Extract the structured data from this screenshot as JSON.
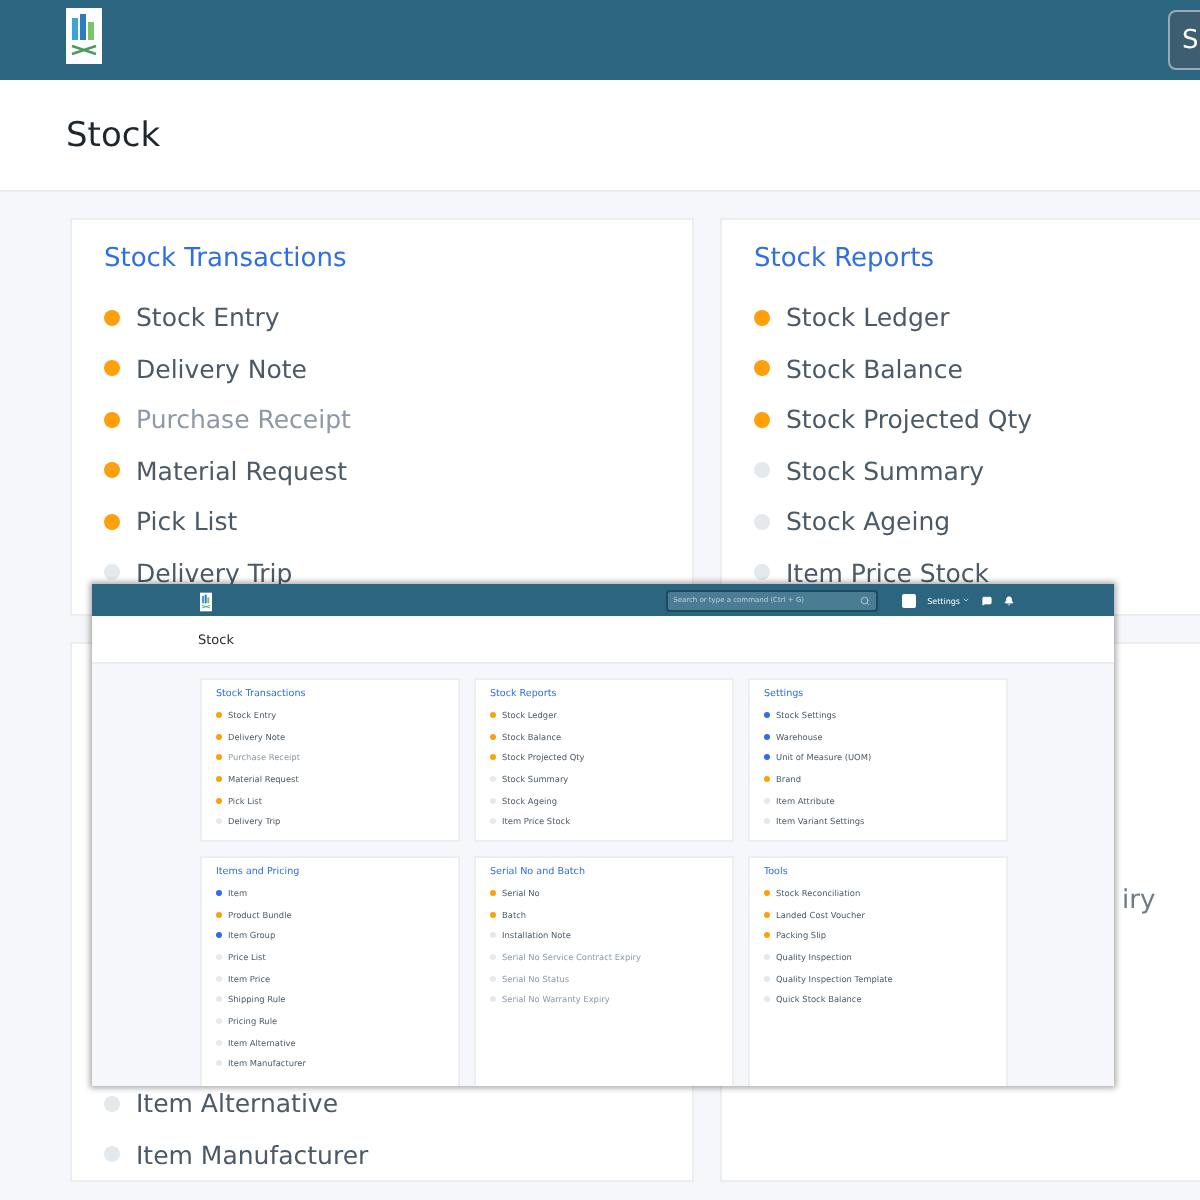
{
  "background": {
    "navbar": {
      "button_text": "S"
    },
    "page_title": "Stock",
    "cards": [
      {
        "title": "Stock Transactions",
        "items": [
          {
            "label": "Stock Entry",
            "color": "#ffa00a",
            "dimmed": false
          },
          {
            "label": "Delivery Note",
            "color": "#ffa00a",
            "dimmed": false
          },
          {
            "label": "Purchase Receipt",
            "color": "#ffa00a",
            "dimmed": true
          },
          {
            "label": "Material Request",
            "color": "#ffa00a",
            "dimmed": false
          },
          {
            "label": "Pick List",
            "color": "#ffa00a",
            "dimmed": false
          },
          {
            "label": "Delivery Trip",
            "color": "#e4e9ee",
            "dimmed": false
          }
        ]
      },
      {
        "title": "Stock Reports",
        "items": [
          {
            "label": "Stock Ledger",
            "color": "#ffa00a",
            "dimmed": false
          },
          {
            "label": "Stock Balance",
            "color": "#ffa00a",
            "dimmed": false
          },
          {
            "label": "Stock Projected Qty",
            "color": "#ffa00a",
            "dimmed": false
          },
          {
            "label": "Stock Summary",
            "color": "#e4e9ee",
            "dimmed": false
          },
          {
            "label": "Stock Ageing",
            "color": "#e4e9ee",
            "dimmed": false
          },
          {
            "label": "Item Price Stock",
            "color": "#e4e9ee",
            "dimmed": false
          }
        ]
      }
    ],
    "lower_left_items": [
      {
        "label": "Item Alternative",
        "color": "#e4e9ee",
        "dimmed": false
      },
      {
        "label": "Item Manufacturer",
        "color": "#e4e9ee",
        "dimmed": false
      }
    ],
    "lower_right_fragment": "iry"
  },
  "window": {
    "navbar": {
      "search_placeholder": "Search or type a command (Ctrl + G)",
      "settings_label": "Settings"
    },
    "page_title": "Stock",
    "cards": [
      {
        "title": "Stock Transactions",
        "items": [
          {
            "label": "Stock Entry",
            "color": "#ffa00a",
            "dimmed": false
          },
          {
            "label": "Delivery Note",
            "color": "#ffa00a",
            "dimmed": false
          },
          {
            "label": "Purchase Receipt",
            "color": "#ffa00a",
            "dimmed": true
          },
          {
            "label": "Material Request",
            "color": "#ffa00a",
            "dimmed": false
          },
          {
            "label": "Pick List",
            "color": "#ffa00a",
            "dimmed": false
          },
          {
            "label": "Delivery Trip",
            "color": "#e4e9ee",
            "dimmed": false
          }
        ]
      },
      {
        "title": "Stock Reports",
        "items": [
          {
            "label": "Stock Ledger",
            "color": "#ffa00a",
            "dimmed": false
          },
          {
            "label": "Stock Balance",
            "color": "#ffa00a",
            "dimmed": false
          },
          {
            "label": "Stock Projected Qty",
            "color": "#ffa00a",
            "dimmed": false
          },
          {
            "label": "Stock Summary",
            "color": "#e4e9ee",
            "dimmed": false
          },
          {
            "label": "Stock Ageing",
            "color": "#e4e9ee",
            "dimmed": false
          },
          {
            "label": "Item Price Stock",
            "color": "#e4e9ee",
            "dimmed": false
          }
        ]
      },
      {
        "title": "Settings",
        "items": [
          {
            "label": "Stock Settings",
            "color": "#2d6bf0",
            "dimmed": false
          },
          {
            "label": "Warehouse",
            "color": "#2d6bf0",
            "dimmed": false
          },
          {
            "label": "Unit of Measure (UOM)",
            "color": "#2d6bf0",
            "dimmed": false
          },
          {
            "label": "Brand",
            "color": "#ffa00a",
            "dimmed": false
          },
          {
            "label": "Item Attribute",
            "color": "#e4e9ee",
            "dimmed": false
          },
          {
            "label": "Item Variant Settings",
            "color": "#e4e9ee",
            "dimmed": false
          }
        ]
      },
      {
        "title": "Items and Pricing",
        "items": [
          {
            "label": "Item",
            "color": "#2d6bf0",
            "dimmed": false
          },
          {
            "label": "Product Bundle",
            "color": "#ffa00a",
            "dimmed": false
          },
          {
            "label": "Item Group",
            "color": "#2d6bf0",
            "dimmed": false
          },
          {
            "label": "Price List",
            "color": "#e4e9ee",
            "dimmed": false
          },
          {
            "label": "Item Price",
            "color": "#e4e9ee",
            "dimmed": false
          },
          {
            "label": "Shipping Rule",
            "color": "#e4e9ee",
            "dimmed": false
          },
          {
            "label": "Pricing Rule",
            "color": "#e4e9ee",
            "dimmed": false
          },
          {
            "label": "Item Alternative",
            "color": "#e4e9ee",
            "dimmed": false
          },
          {
            "label": "Item Manufacturer",
            "color": "#e4e9ee",
            "dimmed": false
          }
        ]
      },
      {
        "title": "Serial No and Batch",
        "items": [
          {
            "label": "Serial No",
            "color": "#ffa00a",
            "dimmed": false
          },
          {
            "label": "Batch",
            "color": "#ffa00a",
            "dimmed": false
          },
          {
            "label": "Installation Note",
            "color": "#e4e9ee",
            "dimmed": false
          },
          {
            "label": "Serial No Service Contract Expiry",
            "color": "#e4e9ee",
            "dimmed": true
          },
          {
            "label": "Serial No Status",
            "color": "#e4e9ee",
            "dimmed": true
          },
          {
            "label": "Serial No Warranty Expiry",
            "color": "#e4e9ee",
            "dimmed": true
          }
        ]
      },
      {
        "title": "Tools",
        "items": [
          {
            "label": "Stock Reconciliation",
            "color": "#ffa00a",
            "dimmed": false
          },
          {
            "label": "Landed Cost Voucher",
            "color": "#ffa00a",
            "dimmed": false
          },
          {
            "label": "Packing Slip",
            "color": "#ffa00a",
            "dimmed": false
          },
          {
            "label": "Quality Inspection",
            "color": "#e4e9ee",
            "dimmed": false
          },
          {
            "label": "Quality Inspection Template",
            "color": "#e4e9ee",
            "dimmed": false
          },
          {
            "label": "Quick Stock Balance",
            "color": "#e4e9ee",
            "dimmed": false
          }
        ]
      }
    ]
  }
}
